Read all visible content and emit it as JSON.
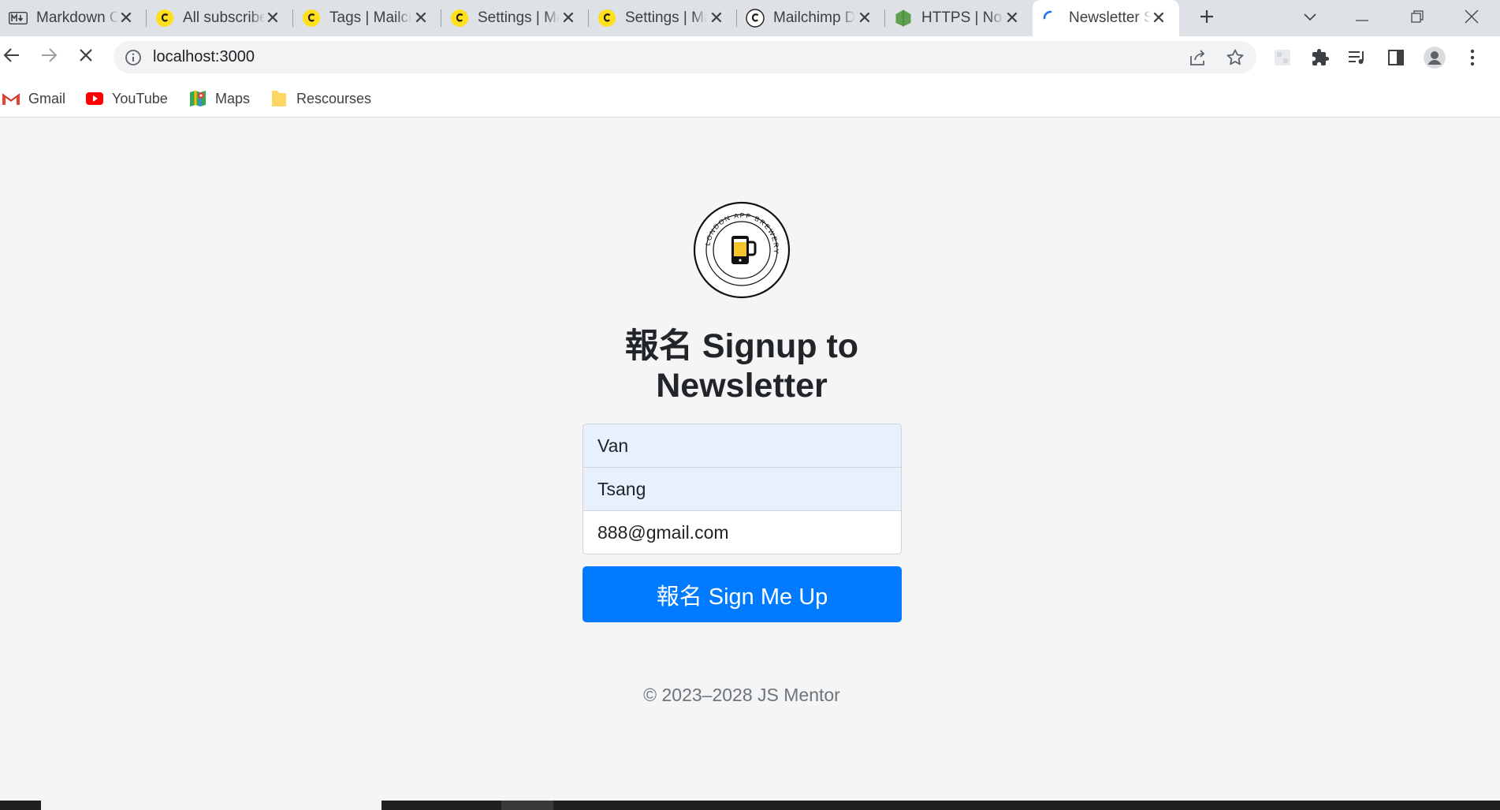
{
  "browser": {
    "tabs": [
      {
        "title": "Markdown Online Editor",
        "icon": "markdown-icon",
        "active": false
      },
      {
        "title": "All subscribers | Mailchimp",
        "icon": "mailchimp-icon",
        "active": false
      },
      {
        "title": "Tags | Mailchimp",
        "icon": "mailchimp-icon",
        "active": false
      },
      {
        "title": "Settings | Mailchimp",
        "icon": "mailchimp-icon",
        "active": false
      },
      {
        "title": "Settings | Mailchimp",
        "icon": "mailchimp-icon",
        "active": false
      },
      {
        "title": "Mailchimp Developer",
        "icon": "mailchimp-dark-icon",
        "active": false
      },
      {
        "title": "HTTPS | Node.js",
        "icon": "nodejs-icon",
        "active": false
      },
      {
        "title": "Newsletter Signup",
        "icon": "loading-spinner-icon",
        "active": true
      }
    ],
    "address_bar": {
      "url": "localhost:3000"
    },
    "bookmarks": [
      {
        "label": "Gmail",
        "icon": "gmail-icon"
      },
      {
        "label": "YouTube",
        "icon": "youtube-icon"
      },
      {
        "label": "Maps",
        "icon": "maps-icon"
      },
      {
        "label": "Rescourses",
        "icon": "folder-icon"
      }
    ]
  },
  "page": {
    "logo": {
      "ring_text": "LONDON APP BREWERY"
    },
    "heading": "報名 Signup to Newsletter",
    "form": {
      "first_name": "Van",
      "last_name": "Tsang",
      "email": "888@gmail.com",
      "submit_label": "報名 Sign Me Up"
    },
    "footer": "© 2023–2028 JS Mentor"
  },
  "colors": {
    "primary_button": "#007bff",
    "autofill_background": "#e8f0fe",
    "page_background": "#f5f5f5",
    "tab_strip": "#dee1e6"
  }
}
